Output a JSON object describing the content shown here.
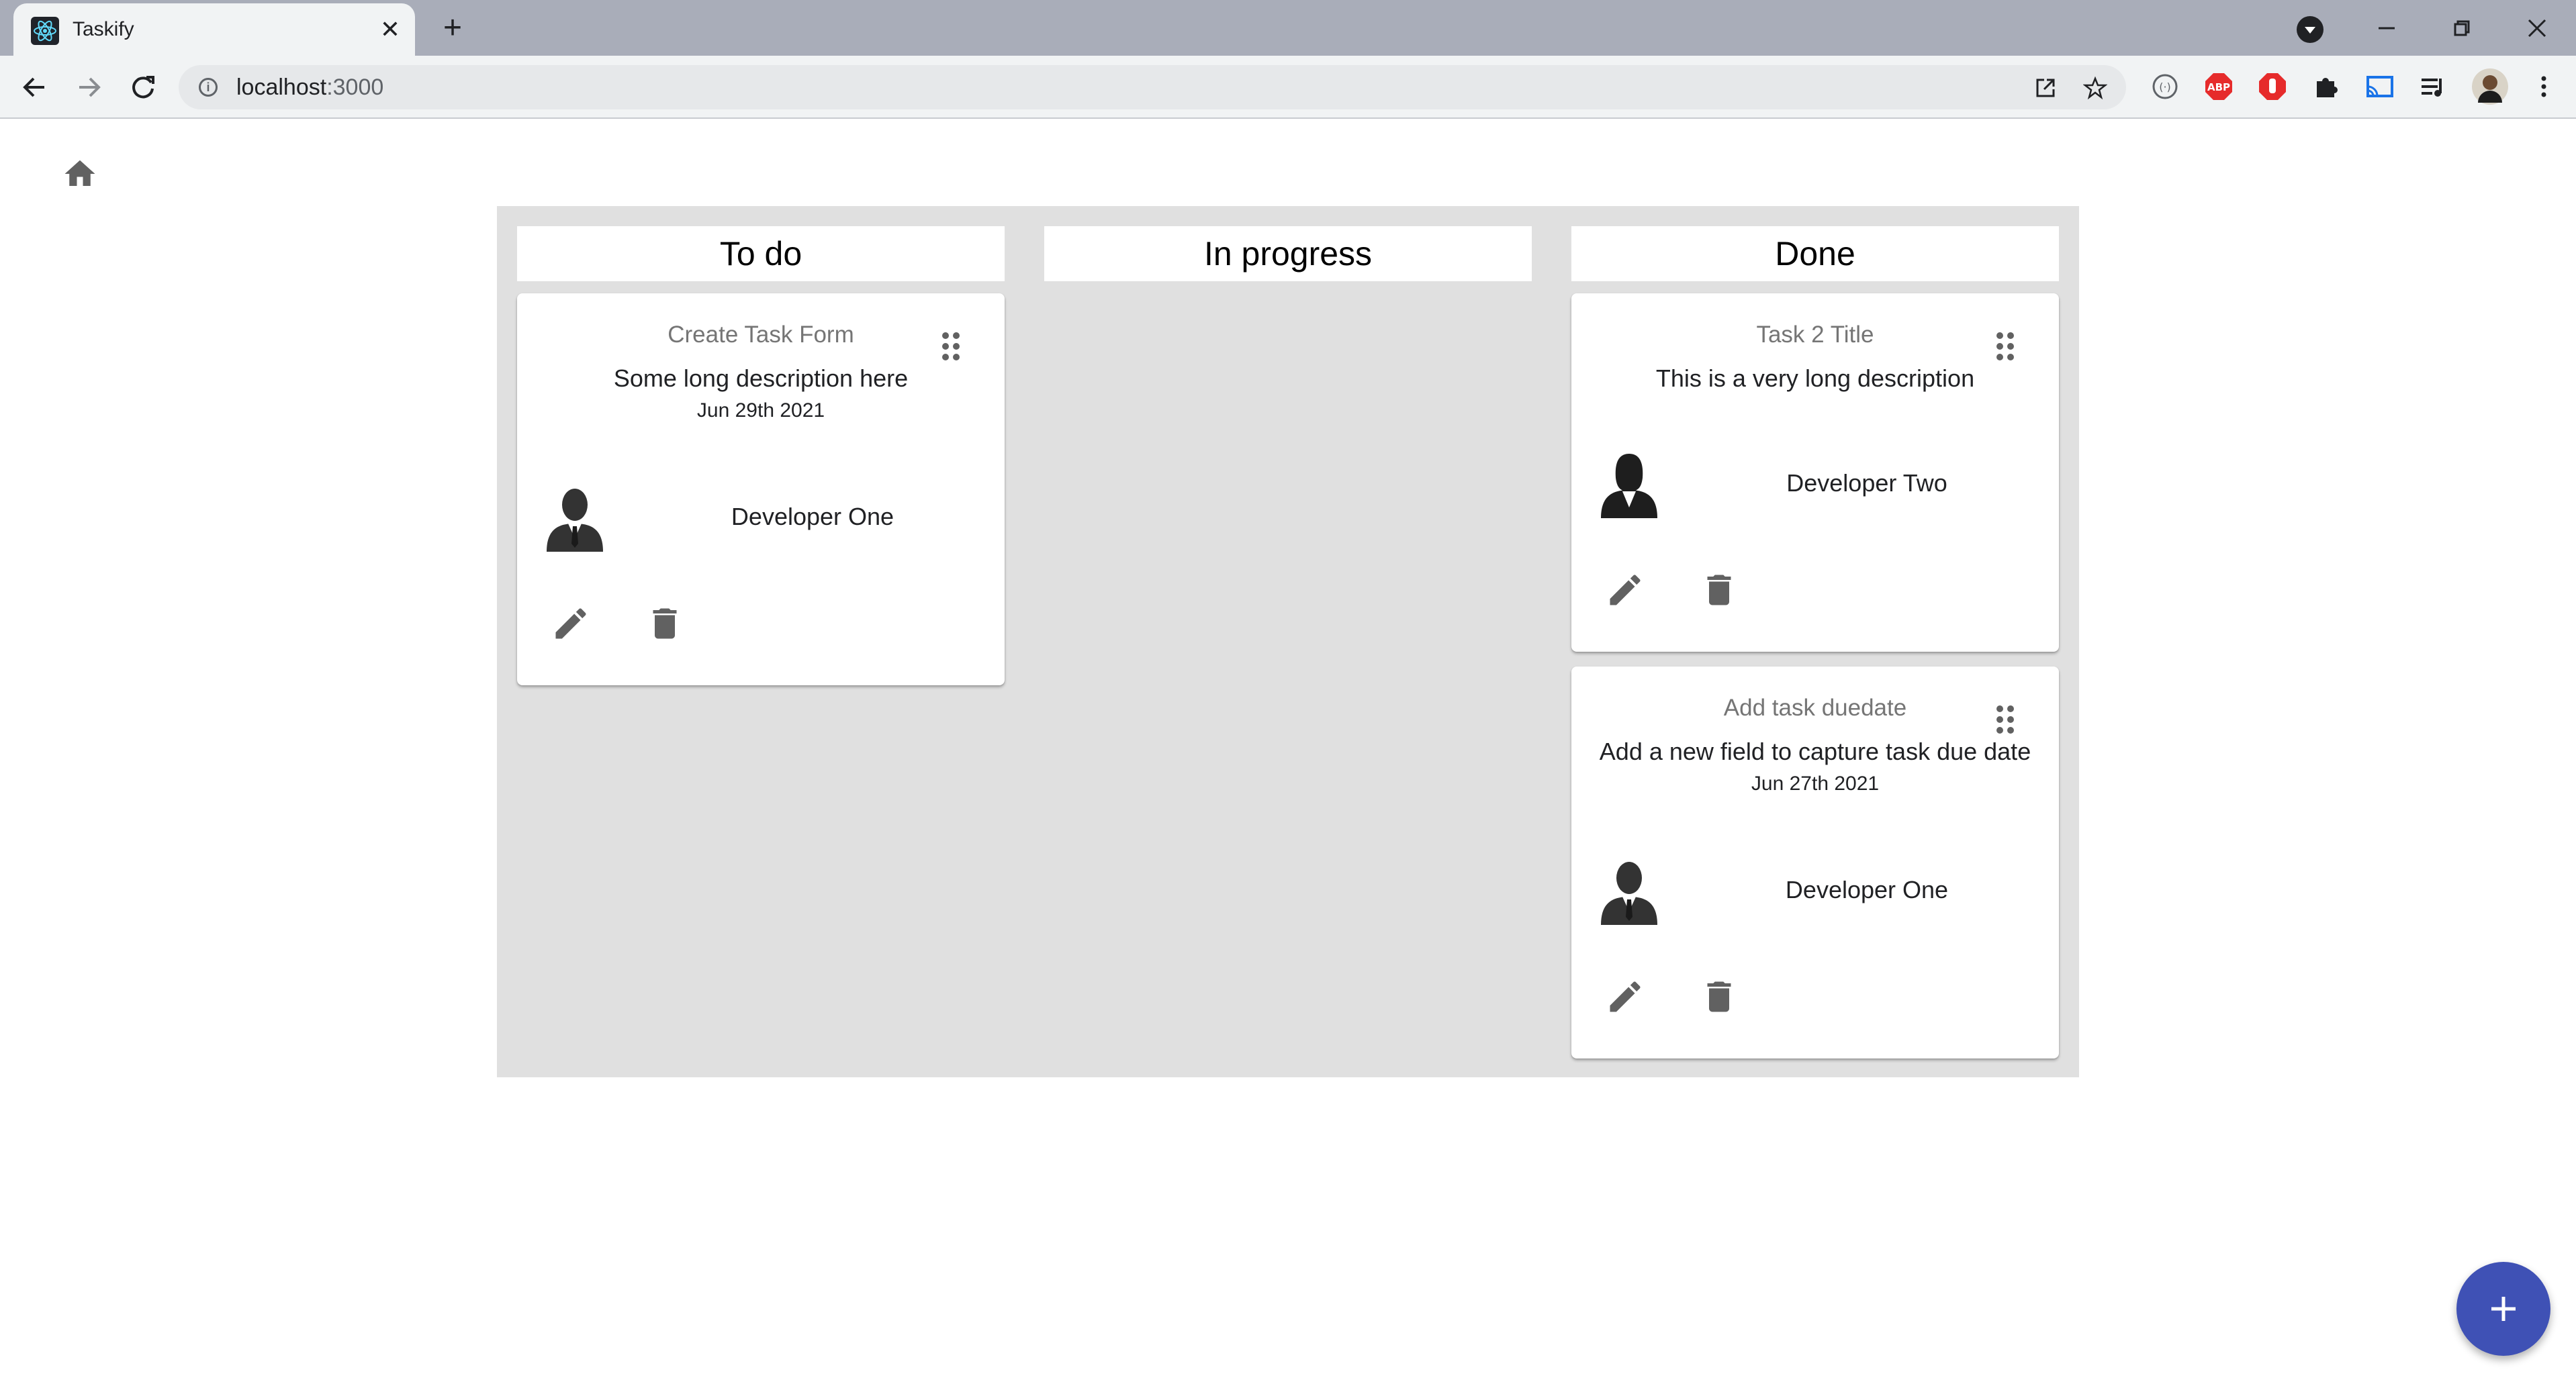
{
  "browser": {
    "tab_title": "Taskify",
    "address": {
      "host": "localhost",
      "port": ":3000"
    },
    "extensions": [
      "abp-icon",
      "stop-icon",
      "puzzle-icon",
      "cast-icon",
      "media-icon"
    ]
  },
  "board": {
    "columns": [
      {
        "title": "To do",
        "cards": [
          {
            "title": "Create Task Form",
            "description": "Some long description here",
            "due_date": "Jun 29th 2021",
            "assignee": "Developer One",
            "avatar": "male-avatar"
          }
        ]
      },
      {
        "title": "In progress",
        "cards": []
      },
      {
        "title": "Done",
        "cards": [
          {
            "title": "Task 2 Title",
            "description": "This is a very long description",
            "due_date": "",
            "assignee": "Developer Two",
            "avatar": "female-avatar"
          },
          {
            "title": "Add task duedate",
            "description": "Add a new field to capture task due date",
            "due_date": "Jun 27th 2021",
            "assignee": "Developer One",
            "avatar": "male-avatar"
          }
        ]
      }
    ]
  },
  "colors": {
    "board_bg": "#e0e0e0",
    "fab": "#3f51b5",
    "icon_gray": "#616161"
  }
}
